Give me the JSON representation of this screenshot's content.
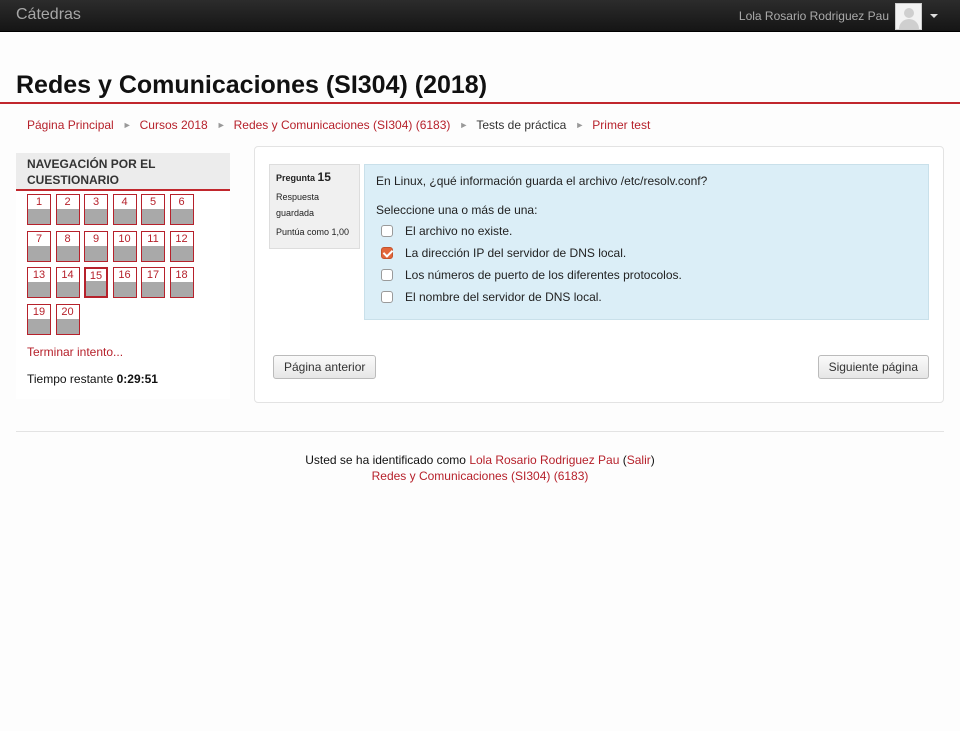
{
  "topbar": {
    "brand": "Cátedras",
    "user_name": "Lola Rosario Rodriguez Pau"
  },
  "page_title": "Redes y Comunicaciones (SI304) (2018)",
  "breadcrumb": [
    {
      "label": "Página Principal",
      "link": true
    },
    {
      "label": "Cursos 2018",
      "link": true
    },
    {
      "label": "Redes y Comunicaciones (SI304) (6183)",
      "link": true
    },
    {
      "label": "Tests de práctica",
      "link": false
    },
    {
      "label": "Primer test",
      "link": true
    }
  ],
  "quiz_nav": {
    "heading_line1": "NAVEGACIÓN POR EL",
    "heading_line2": "CUESTIONARIO",
    "questions": [
      "1",
      "2",
      "3",
      "4",
      "5",
      "6",
      "7",
      "8",
      "9",
      "10",
      "11",
      "12",
      "13",
      "14",
      "15",
      "16",
      "17",
      "18",
      "19",
      "20"
    ],
    "current_question": "15",
    "finish_link": "Terminar intento...",
    "timer_label": "Tiempo restante",
    "timer_value": "0:29:51"
  },
  "question": {
    "label": "Pregunta",
    "number": "15",
    "state_line1": "Respuesta",
    "state_line2": "guardada",
    "grade": "Puntúa como 1,00",
    "text": "En Linux, ¿qué información guarda el archivo /etc/resolv.conf?",
    "prompt": "Seleccione una o más de una:",
    "options": [
      {
        "label": "El archivo no existe.",
        "checked": false
      },
      {
        "label": "La dirección IP del servidor de DNS local.",
        "checked": true
      },
      {
        "label": "Los números de puerto de los diferentes protocolos.",
        "checked": false
      },
      {
        "label": "El nombre del servidor de DNS local.",
        "checked": false
      }
    ]
  },
  "buttons": {
    "prev": "Página anterior",
    "next": "Siguiente página"
  },
  "footer": {
    "logged_in_prefix": "Usted se ha identificado como ",
    "user_link": "Lola Rosario Rodriguez Pau",
    "open_paren": " (",
    "logout": "Salir",
    "close_paren": ")",
    "course_link": "Redes y Comunicaciones (SI304) (6183)"
  },
  "colors": {
    "accent": "#b6212b",
    "question_bg": "#dbeef7",
    "checkbox_checked": "#e2663a"
  }
}
